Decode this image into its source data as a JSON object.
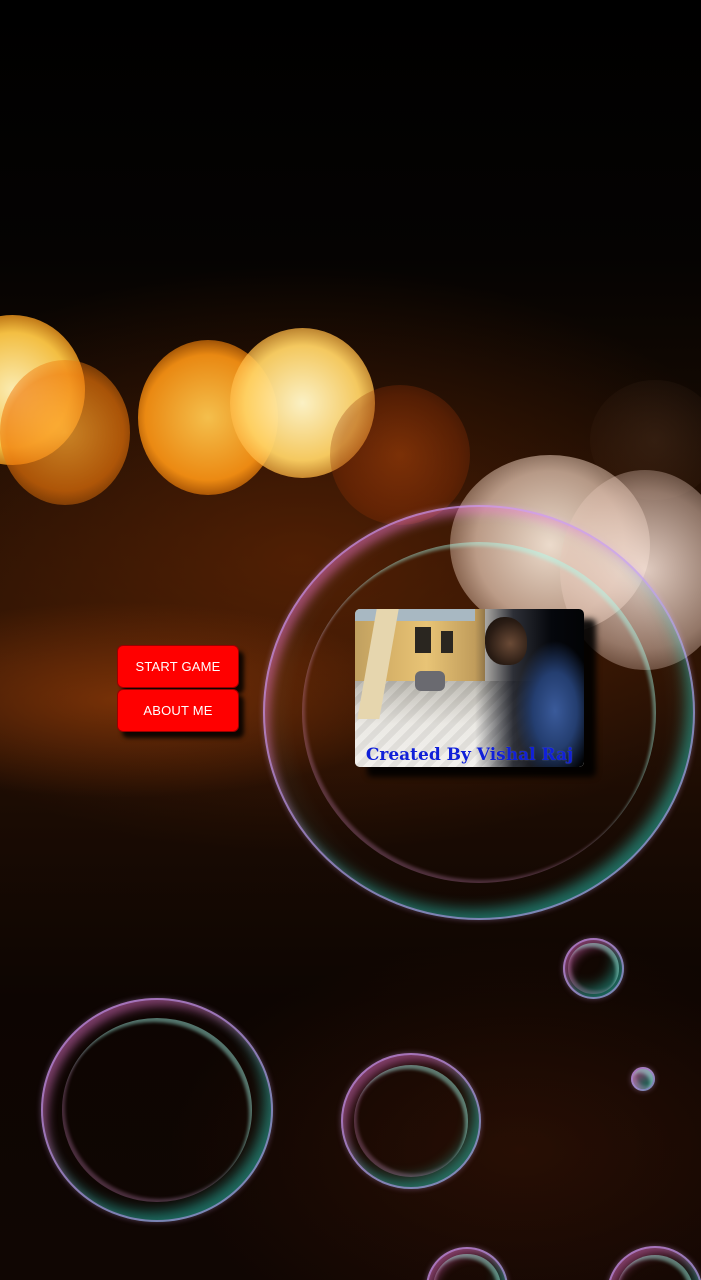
{
  "menu": {
    "start_label": "START GAME",
    "about_label": "ABOUT ME"
  },
  "creator_card": {
    "caption": "Created By Vishal Raj"
  },
  "colors": {
    "button_bg": "#ff0000",
    "button_text": "#ffffff",
    "caption_text": "#1020d8"
  }
}
